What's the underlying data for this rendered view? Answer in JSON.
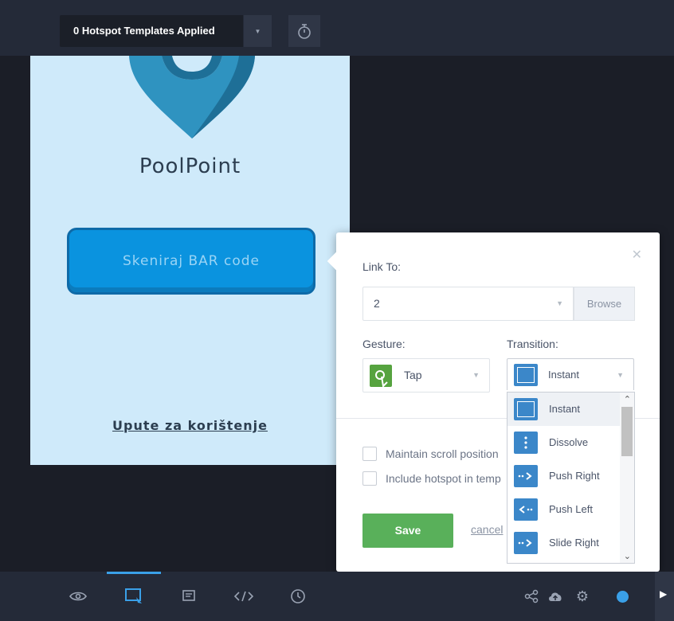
{
  "topbar": {
    "templates_label": "0 Hotspot Templates Applied",
    "caret_icon": "caret-down-icon",
    "timer_icon": "stopwatch-icon"
  },
  "screen": {
    "app_name": "PoolPoint",
    "scan_button": "Skeniraj BAR code",
    "guide_link": "Upute za korištenje",
    "logo_icon": "location-pin-logo"
  },
  "popover": {
    "link_to_label": "Link To:",
    "link_value": "2",
    "browse_label": "Browse",
    "gesture_label": "Gesture:",
    "gesture_value": "Tap",
    "transition_label": "Transition:",
    "transition_value": "Instant",
    "maintain_scroll_label": "Maintain scroll position",
    "include_hotspot_label": "Include hotspot in temp",
    "save_label": "Save",
    "cancel_label": "cancel"
  },
  "transitions": [
    {
      "label": "Instant",
      "icon": "instant-icon"
    },
    {
      "label": "Dissolve",
      "icon": "dissolve-icon"
    },
    {
      "label": "Push Right",
      "icon": "push-right-icon"
    },
    {
      "label": "Push Left",
      "icon": "push-left-icon"
    },
    {
      "label": "Slide Right",
      "icon": "slide-right-icon"
    }
  ],
  "bottombar": {
    "tools": [
      "preview-icon",
      "hotspot-icon",
      "comment-icon",
      "code-icon",
      "history-icon"
    ],
    "right_tools": [
      "share-icon",
      "cloud-upload-icon",
      "settings-icon",
      "status-dot-icon"
    ]
  },
  "colors": {
    "accent": "#3aa0e8",
    "save": "#59b05a",
    "transition_icon": "#3b87c9",
    "gesture_icon": "#56a33f"
  }
}
